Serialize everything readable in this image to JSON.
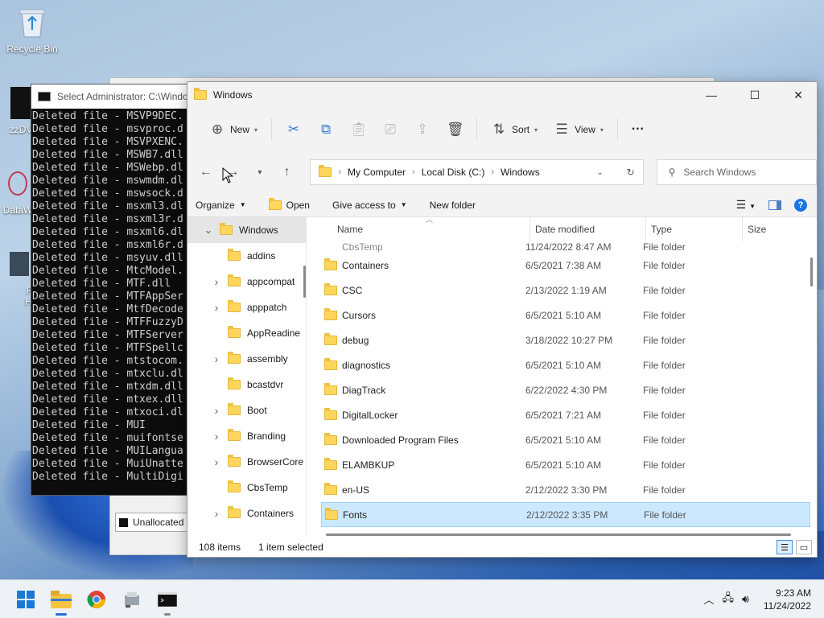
{
  "desktop": {
    "icons": [
      {
        "label": "Recycle Bin"
      },
      {
        "label": "zzDV"
      },
      {
        "label": "DataW"
      },
      {
        "label": "Pro Had"
      }
    ]
  },
  "console": {
    "title": "Select Administrator: C:\\Windo",
    "lines": [
      "Deleted file - MSVP9DEC.",
      "Deleted file - msvproc.d",
      "Deleted file - MSVPXENC.",
      "Deleted file - MSWB7.dll",
      "Deleted file - MSWebp.dl",
      "Deleted file - mswmdm.dl",
      "Deleted file - mswsock.d",
      "Deleted file - msxml3.dl",
      "Deleted file - msxml3r.d",
      "Deleted file - msxml6.dl",
      "Deleted file - msxml6r.d",
      "Deleted file - msyuv.dll",
      "Deleted file - MtcModel.",
      "Deleted file - MTF.dll",
      "Deleted file - MTFAppSer",
      "Deleted file - MtfDecode",
      "Deleted file - MTFFuzzyD",
      "Deleted file - MTFServer",
      "Deleted file - MTFSpellc",
      "Deleted file - mtstocom.",
      "Deleted file - mtxclu.dl",
      "Deleted file - mtxdm.dll",
      "Deleted file - mtxex.dll",
      "Deleted file - mtxoci.dl",
      "Deleted file - MUI",
      "Deleted file - muifontse",
      "Deleted file - MUILangua",
      "Deleted file - MuiUnatte",
      "Deleted file - MultiDigi"
    ]
  },
  "bgwindow": {
    "unallocated": "Unallocated"
  },
  "explorer": {
    "title": "Windows",
    "toolbar": {
      "new": "New",
      "sort": "Sort",
      "view": "View",
      "more": "···"
    },
    "address": {
      "crumbs": [
        "My Computer",
        "Local Disk (C:)",
        "Windows"
      ]
    },
    "search": {
      "placeholder": "Search Windows"
    },
    "classic": {
      "organize": "Organize",
      "open": "Open",
      "give_access": "Give access to",
      "new_folder": "New folder"
    },
    "tree": [
      {
        "label": "Windows",
        "expander": "expanded",
        "selected": true,
        "level": 0
      },
      {
        "label": "addins",
        "expander": "none",
        "level": 1
      },
      {
        "label": "appcompat",
        "expander": "collapsed",
        "level": 1
      },
      {
        "label": "apppatch",
        "expander": "collapsed",
        "level": 1
      },
      {
        "label": "AppReadine",
        "expander": "none",
        "level": 1
      },
      {
        "label": "assembly",
        "expander": "collapsed",
        "level": 1
      },
      {
        "label": "bcastdvr",
        "expander": "none",
        "level": 1
      },
      {
        "label": "Boot",
        "expander": "collapsed",
        "level": 1
      },
      {
        "label": "Branding",
        "expander": "collapsed",
        "level": 1
      },
      {
        "label": "BrowserCore",
        "expander": "collapsed",
        "level": 1
      },
      {
        "label": "CbsTemp",
        "expander": "none",
        "level": 1
      },
      {
        "label": "Containers",
        "expander": "collapsed",
        "level": 1
      }
    ],
    "columns": {
      "name": "Name",
      "date": "Date modified",
      "type": "Type",
      "size": "Size"
    },
    "partial_row": {
      "name": "CbsTemp",
      "date": "11/24/2022 8:47 AM",
      "type": "File folder"
    },
    "rows": [
      {
        "name": "Containers",
        "date": "6/5/2021 7:38 AM",
        "type": "File folder"
      },
      {
        "name": "CSC",
        "date": "2/13/2022 1:19 AM",
        "type": "File folder"
      },
      {
        "name": "Cursors",
        "date": "6/5/2021 5:10 AM",
        "type": "File folder"
      },
      {
        "name": "debug",
        "date": "3/18/2022 10:27 PM",
        "type": "File folder"
      },
      {
        "name": "diagnostics",
        "date": "6/5/2021 5:10 AM",
        "type": "File folder"
      },
      {
        "name": "DiagTrack",
        "date": "6/22/2022 4:30 PM",
        "type": "File folder"
      },
      {
        "name": "DigitalLocker",
        "date": "6/5/2021 7:21 AM",
        "type": "File folder"
      },
      {
        "name": "Downloaded Program Files",
        "date": "6/5/2021 5:10 AM",
        "type": "File folder"
      },
      {
        "name": "ELAMBKUP",
        "date": "6/5/2021 5:10 AM",
        "type": "File folder"
      },
      {
        "name": "en-US",
        "date": "2/12/2022 3:30 PM",
        "type": "File folder"
      },
      {
        "name": "Fonts",
        "date": "2/12/2022 3:35 PM",
        "type": "File folder",
        "selected": true
      }
    ],
    "status": {
      "items": "108 items",
      "selected": "1 item selected"
    }
  },
  "taskbar": {
    "apps": [
      "start-icon",
      "file-explorer-icon",
      "chrome-icon",
      "usb-tool-icon",
      "terminal-icon"
    ],
    "clock": {
      "time": "9:23 AM",
      "date": "11/24/2022"
    }
  }
}
